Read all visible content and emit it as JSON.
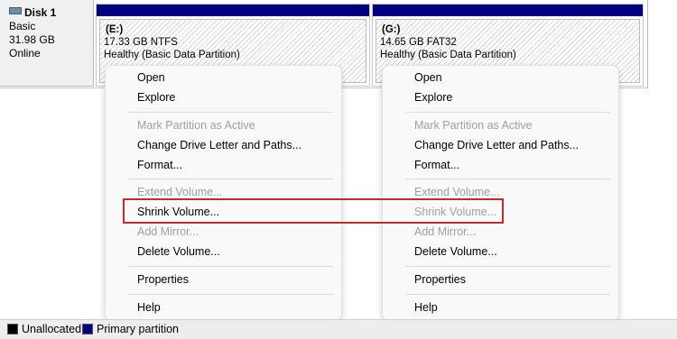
{
  "disk": {
    "name": "Disk 1",
    "type": "Basic",
    "size": "31.98 GB",
    "status": "Online"
  },
  "partitions": [
    {
      "letter": "(E:)",
      "size_fs": "17.33 GB NTFS",
      "health": "Healthy (Basic Data Partition)"
    },
    {
      "letter": "(G:)",
      "size_fs": "14.65 GB FAT32",
      "health": "Healthy (Basic Data Partition)"
    }
  ],
  "menus": [
    {
      "items": [
        {
          "label": "Open",
          "enabled": true
        },
        {
          "label": "Explore",
          "enabled": true
        },
        {
          "label": "Mark Partition as Active",
          "enabled": false
        },
        {
          "label": "Change Drive Letter and Paths...",
          "enabled": true
        },
        {
          "label": "Format...",
          "enabled": true
        },
        {
          "label": "Extend Volume...",
          "enabled": false
        },
        {
          "label": "Shrink Volume...",
          "enabled": true
        },
        {
          "label": "Add Mirror...",
          "enabled": false
        },
        {
          "label": "Delete Volume...",
          "enabled": true
        },
        {
          "label": "Properties",
          "enabled": true
        },
        {
          "label": "Help",
          "enabled": true
        }
      ]
    },
    {
      "items": [
        {
          "label": "Open",
          "enabled": true
        },
        {
          "label": "Explore",
          "enabled": true
        },
        {
          "label": "Mark Partition as Active",
          "enabled": false
        },
        {
          "label": "Change Drive Letter and Paths...",
          "enabled": true
        },
        {
          "label": "Format...",
          "enabled": true
        },
        {
          "label": "Extend Volume...",
          "enabled": false
        },
        {
          "label": "Shrink Volume...",
          "enabled": false
        },
        {
          "label": "Add Mirror...",
          "enabled": false
        },
        {
          "label": "Delete Volume...",
          "enabled": true
        },
        {
          "label": "Properties",
          "enabled": true
        },
        {
          "label": "Help",
          "enabled": true
        }
      ]
    }
  ],
  "legend": {
    "unallocated": "Unallocated",
    "primary": "Primary partition"
  },
  "colors": {
    "primary_partition": "#000080",
    "unallocated": "#000000",
    "highlight": "#c42b2b"
  }
}
